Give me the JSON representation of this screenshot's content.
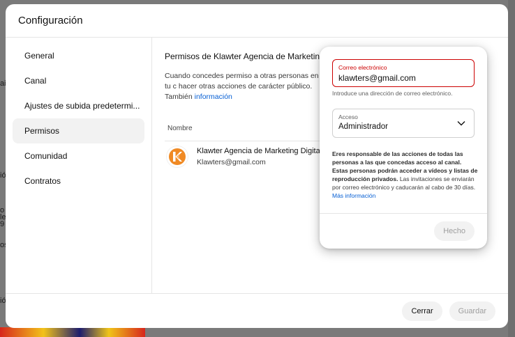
{
  "background": {
    "fragments": [
      "ai",
      "ión",
      "o",
      "le",
      "9",
      "os",
      "ió"
    ]
  },
  "dialog": {
    "title": "Configuración",
    "sidebar": {
      "items": [
        {
          "label": "General"
        },
        {
          "label": "Canal"
        },
        {
          "label": "Ajustes de subida predetermi..."
        },
        {
          "label": "Permisos",
          "active": true
        },
        {
          "label": "Comunidad"
        },
        {
          "label": "Contratos"
        }
      ]
    },
    "content": {
      "title": "Permisos de Klawter Agencia de Marketing D",
      "description": "Cuando concedes permiso a otras personas en tu c hacer otras acciones de carácter público. También ",
      "description_link": "información",
      "column_header": "Nombre",
      "user": {
        "name": "Klawter Agencia de Marketing Digital",
        "email": "Klawters@gmail.com"
      }
    },
    "footer": {
      "close_label": "Cerrar",
      "save_label": "Guardar"
    }
  },
  "popup": {
    "email_label": "Correo electrónico",
    "email_value": "klawters@gmail.com",
    "email_hint": "Introduce una dirección de correo electrónico.",
    "access_label": "Acceso",
    "access_value": "Administrador",
    "notice_bold": "Eres responsable de las acciones de todas las personas a las que concedas acceso al canal. Estas personas podrán acceder a vídeos y listas de reproducción privados.",
    "notice_text": " Las invitaciones se enviarán por correo electrónico y caducarán al cabo de 30 días. ",
    "notice_link": "Más información",
    "done_label": "Hecho"
  },
  "colors": {
    "accent_error": "#cc0000",
    "link": "#065fd4",
    "logo_orange": "#f08a24"
  }
}
